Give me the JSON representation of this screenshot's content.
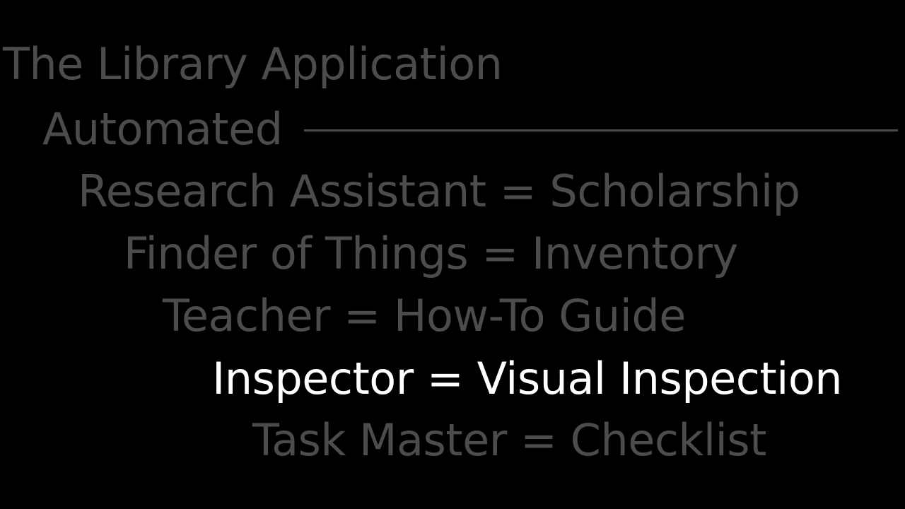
{
  "slide": {
    "title": "The Library Application",
    "subtitle": "Automated",
    "items": [
      {
        "label": "Research Assistant = Scholarship",
        "active": false
      },
      {
        "label": "Finder of  Things = Inventory",
        "active": false
      },
      {
        "label": "Teacher = How-To Guide",
        "active": false
      },
      {
        "label": "Inspector = Visual Inspection",
        "active": true
      },
      {
        "label": "Task Master = Checklist",
        "active": false
      }
    ]
  },
  "colors": {
    "background": "#000000",
    "dimmed_text": "#4c4c4c",
    "highlight_text": "#ffffff"
  }
}
